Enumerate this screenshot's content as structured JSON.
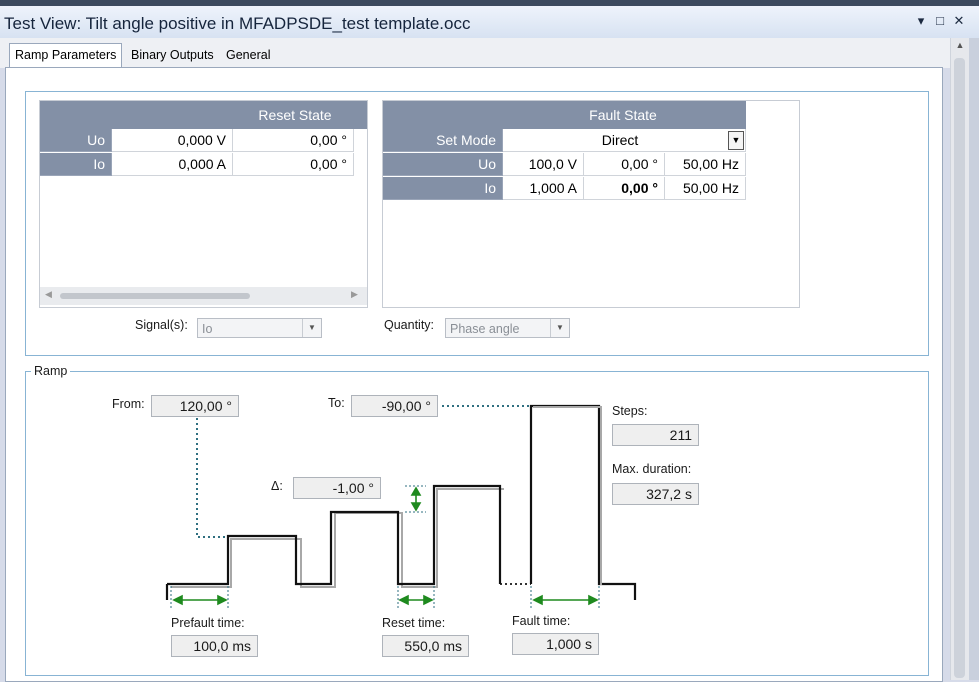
{
  "window": {
    "title": "Test View: Tilt angle positive in MFADPSDE_test template.occ"
  },
  "window_controls": {
    "menu": "▾",
    "maximize": "□",
    "close": "✕"
  },
  "tabs": [
    {
      "label": "Ramp Parameters",
      "active": true
    },
    {
      "label": "Binary Outputs",
      "active": false
    },
    {
      "label": "General",
      "active": false
    }
  ],
  "reset_state": {
    "header": "Reset State",
    "rows": [
      {
        "name": "Uo",
        "magnitude": "0,000 V",
        "angle": "0,00 °"
      },
      {
        "name": "Io",
        "magnitude": "0,000 A",
        "angle": "0,00 °"
      }
    ]
  },
  "fault_state": {
    "header": "Fault State",
    "set_mode_label": "Set Mode",
    "set_mode_value": "Direct",
    "rows": [
      {
        "name": "Uo",
        "magnitude": "100,0 V",
        "angle": "0,00 °",
        "frequency": "50,00 Hz"
      },
      {
        "name": "Io",
        "magnitude": "1,000 A",
        "angle": "0,00 °",
        "frequency": "50,00 Hz"
      }
    ]
  },
  "signals": {
    "label": "Signal(s):",
    "value": "Io"
  },
  "quantity": {
    "label": "Quantity:",
    "value": "Phase angle"
  },
  "ramp": {
    "group_label": "Ramp",
    "from_label": "From:",
    "from_value": "120,00 °",
    "to_label": "To:",
    "to_value": "-90,00 °",
    "delta_label": "Δ:",
    "delta_value": "-1,00 °",
    "steps_label": "Steps:",
    "steps_value": "211",
    "max_duration_label": "Max. duration:",
    "max_duration_value": "327,2 s",
    "prefault_label": "Prefault time:",
    "prefault_value": "100,0 ms",
    "reset_time_label": "Reset time:",
    "reset_time_value": "550,0 ms",
    "fault_time_label": "Fault time:",
    "fault_time_value": "1,000 s"
  },
  "colors": {
    "header": "#8390a6",
    "group_border": "#88b4d4",
    "arrow_green": "#1f8a1f",
    "dotted_teal": "#2f6f80"
  }
}
